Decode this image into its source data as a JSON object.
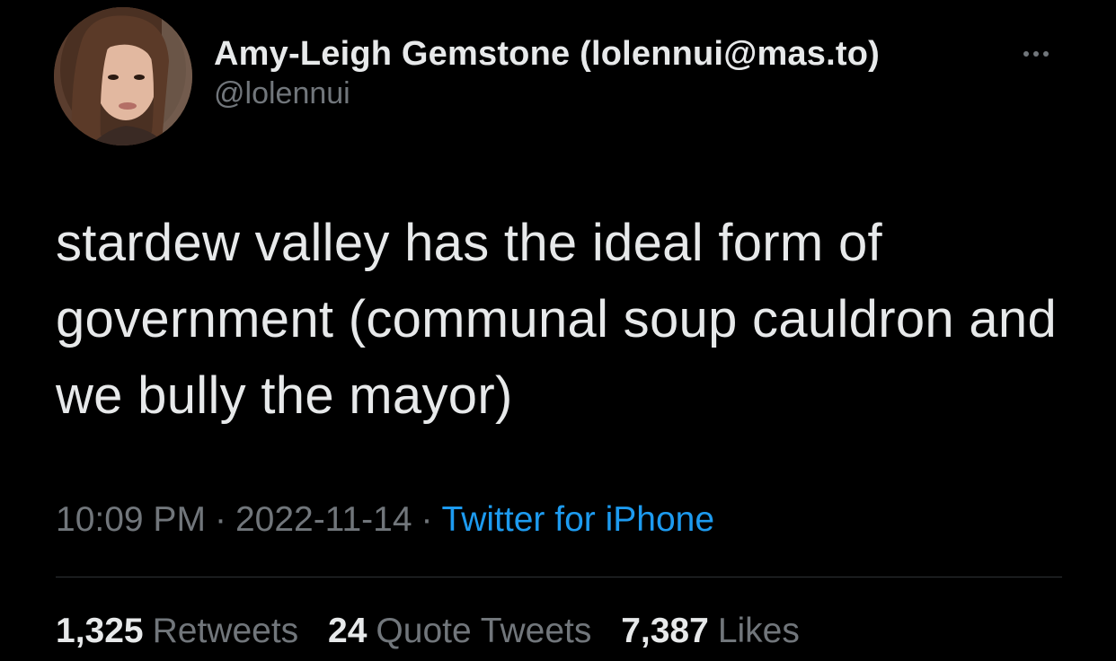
{
  "author": {
    "display_name": "Amy-Leigh Gemstone (lolennui@mas.to)",
    "handle": "@lolennui"
  },
  "tweet": {
    "text": "stardew valley has the ideal form of government (communal soup cauldron and we bully the mayor)"
  },
  "meta": {
    "time": "10:09 PM",
    "separator": "·",
    "date": "2022-11-14",
    "source": "Twitter for iPhone"
  },
  "stats": {
    "retweets_count": "1,325",
    "retweets_label": "Retweets",
    "quotes_count": "24",
    "quotes_label": "Quote Tweets",
    "likes_count": "7,387",
    "likes_label": "Likes"
  },
  "icons": {
    "more": "more-horizontal-icon",
    "avatar": "profile-photo"
  },
  "colors": {
    "background": "#000000",
    "primary_text": "#e7e9ea",
    "secondary_text": "#71767b",
    "link": "#1d9bf0",
    "divider": "#2f3336"
  }
}
